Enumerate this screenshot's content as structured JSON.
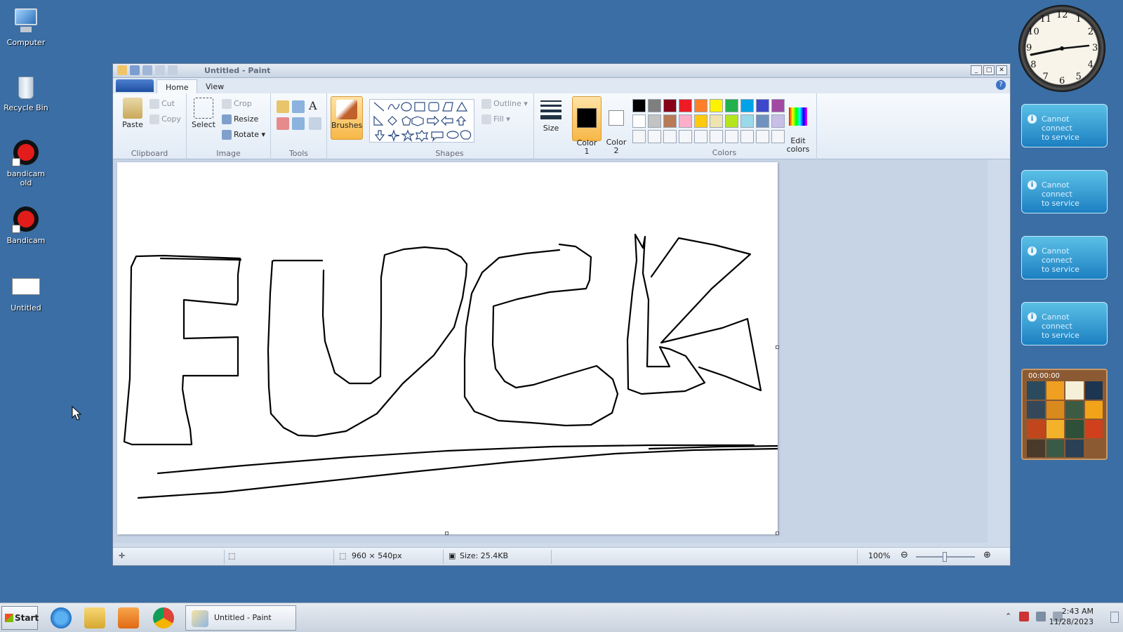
{
  "desktop": {
    "icons": [
      {
        "label": "Computer"
      },
      {
        "label": "Recycle Bin"
      },
      {
        "label": "bandicam old"
      },
      {
        "label": "Bandicam"
      },
      {
        "label": "Untitled"
      }
    ]
  },
  "window": {
    "title": "Untitled - Paint",
    "tabs": [
      "Home",
      "View"
    ],
    "clipboard": {
      "paste": "Paste",
      "cut": "Cut",
      "copy": "Copy",
      "label": "Clipboard"
    },
    "image": {
      "select": "Select",
      "crop": "Crop",
      "resize": "Resize",
      "rotate": "Rotate",
      "label": "Image"
    },
    "tools": {
      "label": "Tools"
    },
    "brushes": "Brushes",
    "shapes": {
      "outline": "Outline",
      "fill": "Fill",
      "label": "Shapes"
    },
    "size": "Size",
    "color1": "Color\n1",
    "color2": "Color\n2",
    "edit_colors": "Edit\ncolors",
    "colors_label": "Colors",
    "palette_row1": [
      "#000000",
      "#7f7f7f",
      "#880015",
      "#ed1c24",
      "#ff7f27",
      "#fff200",
      "#22b14c",
      "#00a2e8",
      "#3f48cc",
      "#a349a4"
    ],
    "palette_row2": [
      "#ffffff",
      "#c3c3c3",
      "#b97a57",
      "#ffaec9",
      "#ffc90e",
      "#efe4b0",
      "#b5e61d",
      "#99d9ea",
      "#7092be",
      "#c8bfe7"
    ],
    "status": {
      "dimensions": "960 × 540px",
      "size": "Size: 25.4KB",
      "zoom": "100%"
    }
  },
  "gadgets": {
    "clock_numbers": [
      "12",
      "1",
      "2",
      "3",
      "4",
      "5",
      "6",
      "7",
      "8",
      "9",
      "10",
      "11"
    ],
    "weather": [
      {
        "line1": "Cannot connect",
        "line2": "to service"
      },
      {
        "line1": "Cannot connect",
        "line2": "to service"
      },
      {
        "line1": "Cannot connect",
        "line2": "to service"
      },
      {
        "line1": "Cannot connect",
        "line2": "to service"
      }
    ],
    "puzzle_timer": "00:00:00"
  },
  "taskbar": {
    "start": "Start",
    "task": "Untitled - Paint",
    "time": "2:43 AM",
    "date": "11/28/2023"
  }
}
